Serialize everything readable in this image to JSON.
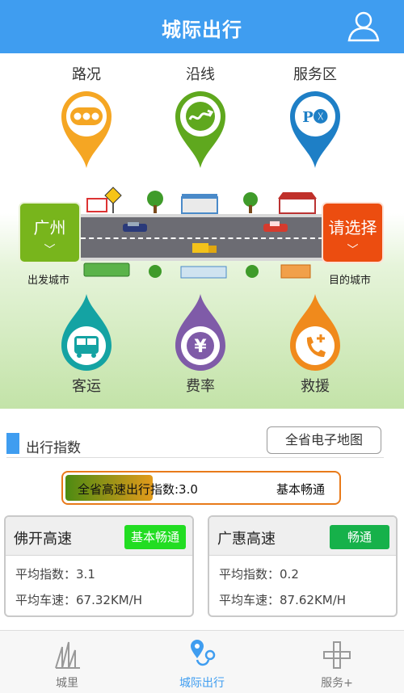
{
  "header": {
    "title": "城际出行",
    "user_icon": "user-icon"
  },
  "top_features": [
    {
      "label": "路况",
      "icon": "traffic-light-icon",
      "color": "#f5a623"
    },
    {
      "label": "沿线",
      "icon": "route-icon",
      "color": "#5fa81e"
    },
    {
      "label": "服务区",
      "icon": "service-area-icon",
      "color": "#1e7fc6"
    }
  ],
  "route": {
    "from_city": "广州",
    "to_city": "请选择",
    "from_caption": "出发城市",
    "to_caption": "目的城市"
  },
  "bottom_features": [
    {
      "label": "客运",
      "icon": "bus-icon",
      "color": "#14a3a3"
    },
    {
      "label": "费率",
      "icon": "yen-icon",
      "color": "#7f5ba8"
    },
    {
      "label": "救援",
      "icon": "rescue-phone-icon",
      "color": "#f08a1c"
    }
  ],
  "travel_index": {
    "section_title": "出行指数",
    "map_button": "全省电子地图",
    "overall_text": "全省高速出行指数:3.0",
    "overall_status": "基本畅通",
    "overall_value": 3.0,
    "overall_fill_fraction": 0.32
  },
  "highways": [
    {
      "name": "佛开高速",
      "status": "基本畅通",
      "status_color": "#22dd22",
      "index_label": "平均指数：",
      "index": "3.1",
      "speed_label": "平均车速：",
      "speed": "67.32KM/H"
    },
    {
      "name": "广惠高速",
      "status": "畅通",
      "status_color": "#16b14a",
      "index_label": "平均指数：",
      "index": "0.2",
      "speed_label": "平均车速：",
      "speed": "87.62KM/H"
    }
  ],
  "tabs": [
    {
      "label": "城里",
      "icon": "city-buildings-icon",
      "active": false
    },
    {
      "label": "城际出行",
      "icon": "intercity-route-icon",
      "active": true
    },
    {
      "label": "服务+",
      "icon": "service-plus-icon",
      "active": false
    }
  ]
}
